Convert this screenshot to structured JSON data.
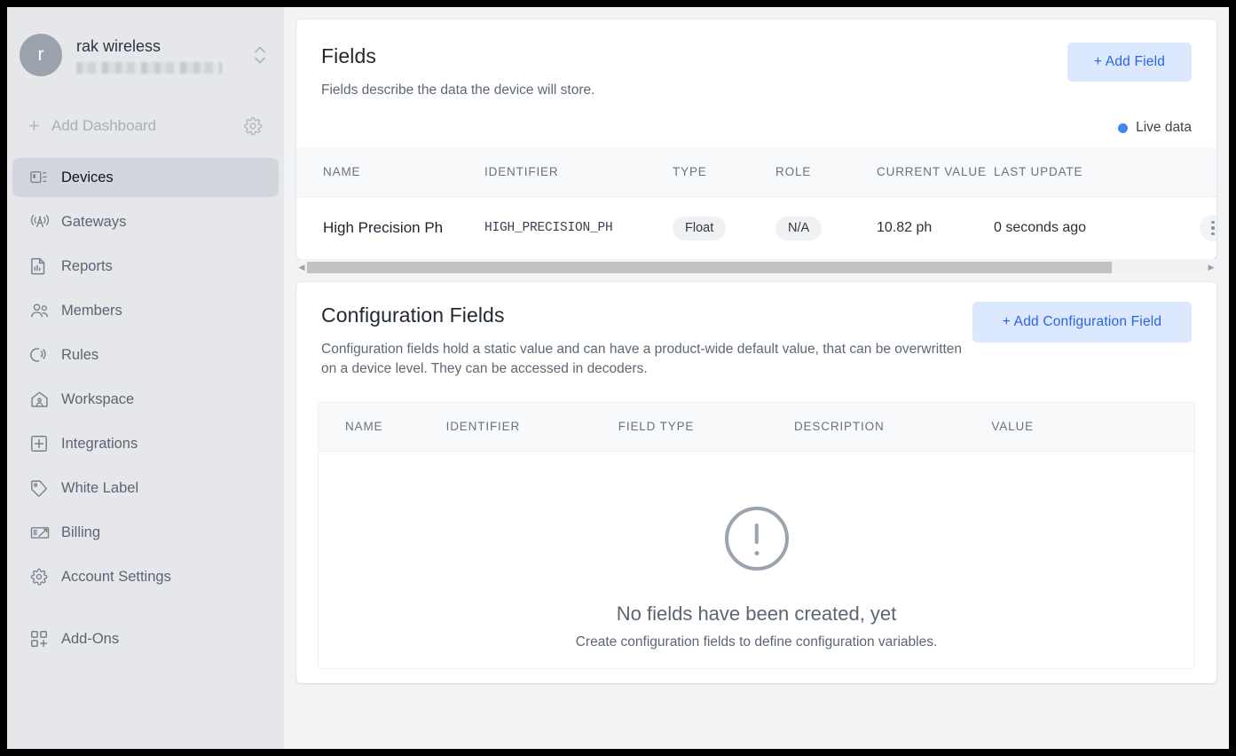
{
  "sidebar": {
    "workspace": {
      "avatar_initial": "r",
      "name": "rak wireless",
      "secondary_redacted": true
    },
    "add_dashboard": {
      "label": "Add Dashboard",
      "plus": "+"
    },
    "items": [
      {
        "label": "Devices",
        "icon": "devices-icon",
        "active": true
      },
      {
        "label": "Gateways",
        "icon": "gateway-antenna-icon",
        "active": false
      },
      {
        "label": "Reports",
        "icon": "report-document-icon",
        "active": false
      },
      {
        "label": "Members",
        "icon": "members-people-icon",
        "active": false
      },
      {
        "label": "Rules",
        "icon": "rules-signal-icon",
        "active": false
      },
      {
        "label": "Workspace",
        "icon": "workspace-home-icon",
        "active": false
      },
      {
        "label": "Integrations",
        "icon": "integrations-plus-square-icon",
        "active": false
      },
      {
        "label": "White Label",
        "icon": "tag-icon",
        "active": false
      },
      {
        "label": "Billing",
        "icon": "billing-check-icon",
        "active": false
      },
      {
        "label": "Account Settings",
        "icon": "gear-icon",
        "active": false
      },
      {
        "label": "Add-Ons",
        "icon": "add-ons-grid-icon",
        "active": false
      }
    ]
  },
  "fields_section": {
    "title": "Fields",
    "subtitle": "Fields describe the data the device will store.",
    "add_button": "+  Add Field",
    "live_data_label": "Live data",
    "live_data_color": "#4285f4",
    "accent_color": "#2b62e8",
    "accent_bg": "#dbe8fe",
    "columns": [
      "NAME",
      "IDENTIFIER",
      "TYPE",
      "ROLE",
      "CURRENT VALUE",
      "LAST UPDATE"
    ],
    "rows": [
      {
        "name": "High Precision Ph",
        "identifier": "HIGH_PRECISION_PH",
        "type": "Float",
        "role": "N/A",
        "current_value": "10.82 ph",
        "last_update": "0 seconds ago",
        "menu": "kebab-menu-icon"
      }
    ]
  },
  "config_section": {
    "title": "Configuration Fields",
    "subtitle": "Configuration fields hold a static value and can have a product-wide default value, that can be overwritten on a device level. They can be accessed in decoders.",
    "add_button": "+  Add Configuration Field",
    "columns": [
      "NAME",
      "IDENTIFIER",
      "FIELD TYPE",
      "DESCRIPTION",
      "VALUE"
    ],
    "empty_state": {
      "icon": "alert-circle-icon",
      "title": "No fields have been created, yet",
      "subtitle": "Create configuration fields to define configuration variables."
    }
  },
  "scrollbar": {
    "left_arrow": "◀",
    "right_arrow": "▶",
    "thumb_percent": "89.5%"
  }
}
